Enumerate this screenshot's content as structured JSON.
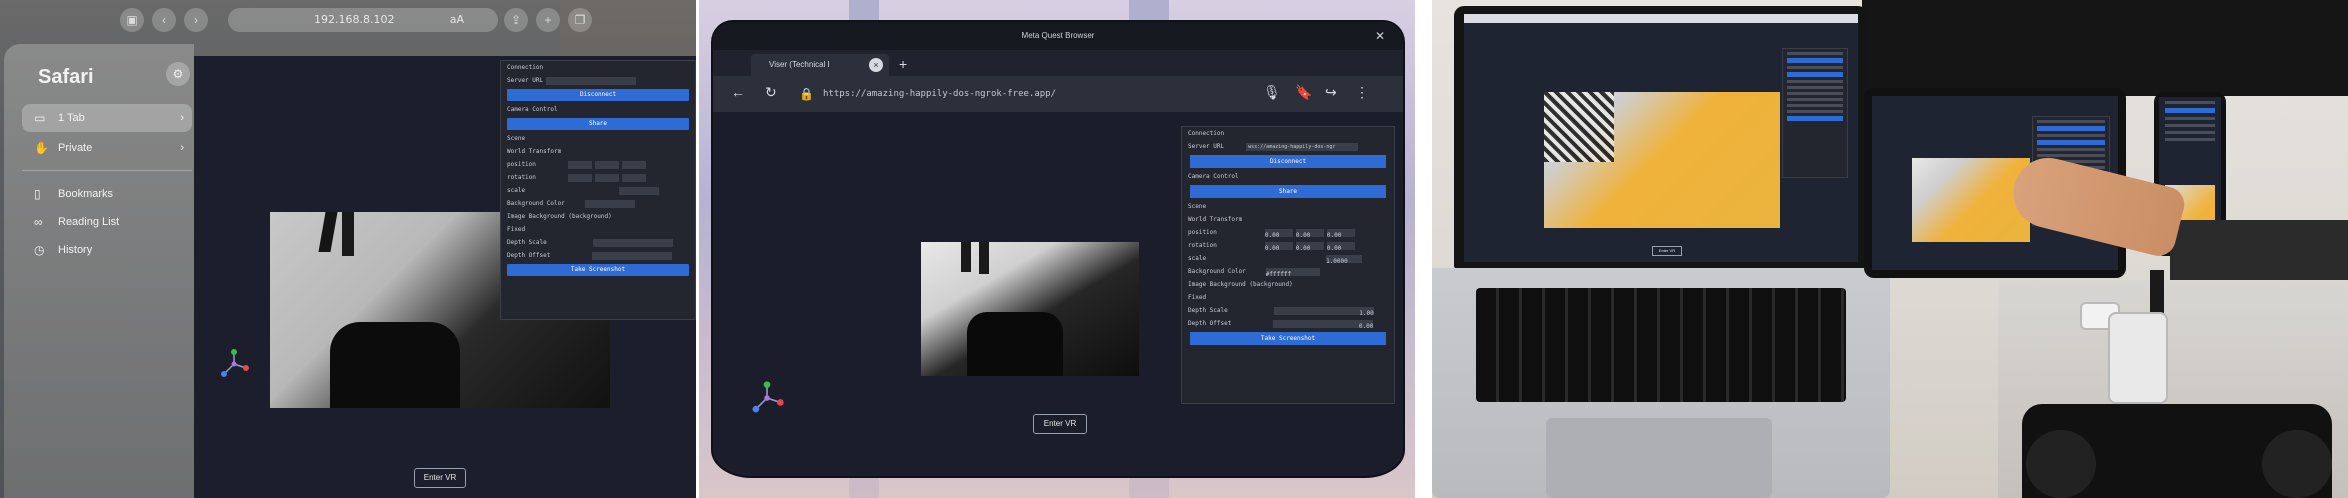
{
  "panel1": {
    "url_text": "192.168.8.102",
    "aa_label": "aA",
    "sidebar_title": "Safari",
    "sidebar_items": [
      {
        "icon": "tab-icon",
        "label": "1 Tab"
      },
      {
        "icon": "hand-raised-icon",
        "label": "Private"
      },
      {
        "icon": "book-icon",
        "label": "Bookmarks"
      },
      {
        "icon": "glasses-icon",
        "label": "Reading List"
      },
      {
        "icon": "clock-icon",
        "label": "History"
      }
    ],
    "gui_rows": [
      "Connection",
      "Server URL",
      "Camera Control",
      "Scene",
      "World Transform",
      "position",
      "rotation",
      "scale",
      "Background Color",
      "Image Background (background)",
      "Fixed",
      "Depth Scale",
      "Depth Offset"
    ],
    "gui_buttons": [
      "Disconnect",
      "Share",
      "Take Screenshot"
    ],
    "enter_vr": "Enter VR"
  },
  "panel2": {
    "window_title": "Meta Quest Browser",
    "tab_title": "Viser (Technical I",
    "url": "https://amazing-happily-dos-ngrok-free.app/",
    "gui_rows": [
      "Connection",
      "Server URL",
      "Camera Control",
      "Scene",
      "World Transform",
      "position",
      "rotation",
      "scale",
      "Background Color",
      "Image Background (background)",
      "Fixed",
      "Depth Scale",
      "Depth Offset"
    ],
    "server_url_value": "wss://amazing-happily-dos-ngr",
    "gui_buttons": [
      "Disconnect",
      "Share",
      "Take Screenshot"
    ],
    "position_values": [
      "0.00",
      "0.00",
      "0.00"
    ],
    "rotation_values": [
      "0.00",
      "0.00",
      "0.00"
    ],
    "scale_value": "1.0000",
    "bg_color_value": "#ffffff",
    "depth_scale_value": "1.00",
    "depth_offset_value": "0.00",
    "enter_vr": "Enter VR"
  },
  "panel3": {
    "laptop_enter_label": "Enter VR"
  }
}
